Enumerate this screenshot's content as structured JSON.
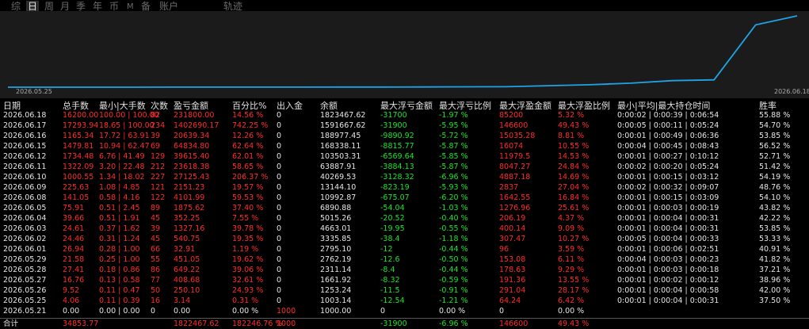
{
  "tabs": [
    {
      "label": "综",
      "active": false
    },
    {
      "label": "日",
      "active": true
    },
    {
      "label": "周",
      "active": false
    },
    {
      "label": "月",
      "active": false
    },
    {
      "label": "季",
      "active": false
    },
    {
      "label": "年",
      "active": false
    },
    {
      "label": "币",
      "active": false
    },
    {
      "label": "M",
      "active": false
    },
    {
      "label": "备",
      "active": false
    },
    {
      "label": "账户",
      "active": false
    },
    {
      "label": "轨迹",
      "active": false
    }
  ],
  "chart": {
    "start_label": "2026.05.25",
    "end_label": "2026.06.18",
    "line_color": "#1fa3e6",
    "curve": [
      1000.0,
      1003.14,
      1253.24,
      1661.92,
      2311.14,
      2762.19,
      2795.1,
      3335.85,
      4663.01,
      5015.26,
      6890.88,
      10992.87,
      13144.1,
      40269.53,
      63887.91,
      103503.31,
      168338.11,
      188977.45,
      1591667.62,
      1823467.62
    ]
  },
  "headers": {
    "date": "日期",
    "total_lots": "总手数",
    "minmax_lots": "最小|大手数",
    "count": "次数",
    "pnl": "盈亏金额",
    "pct": "百分比%",
    "inout": "出入金",
    "balance": "余额",
    "max_float_loss": "最大浮亏金额",
    "max_float_loss_pct": "最大浮亏比例",
    "max_float_profit": "最大浮盈金额",
    "max_float_profit_pct": "最大浮盈比例",
    "hold_time": "最小|平均|最大持仓时间",
    "winrate": "胜率"
  },
  "rows": [
    {
      "date": "2026.06.18",
      "lots": "16200.00",
      "minmax": "100.00 | 100.00",
      "count": "82",
      "pnl": "231800.00",
      "pct": "14.56 %",
      "inout": "0",
      "balance": "1823467.62",
      "mfl": "-31700",
      "mflp": "-1.97 %",
      "mfp": "85200",
      "mfpp": "5.32 %",
      "hold": "0:00:02 | 0:00:39 | 0:06:54",
      "win": "55.88 %"
    },
    {
      "date": "2026.06.17",
      "lots": "17293.94",
      "minmax": "18.65 | 100.00",
      "count": "234",
      "pnl": "1402690.17",
      "pct": "742.25 %",
      "inout": "0",
      "balance": "1591667.62",
      "mfl": "-31900",
      "mflp": "-5.95 %",
      "mfp": "146600",
      "mfpp": "49.43 %",
      "hold": "0:00:05 | 0:00:11 | 0:05:24",
      "win": "54.70 %"
    },
    {
      "date": "2026.06.16",
      "lots": "1165.34",
      "minmax": "17.72 | 63.91",
      "count": "39",
      "pnl": "20639.34",
      "pct": "12.26 %",
      "inout": "0",
      "balance": "188977.45",
      "mfl": "-9890.92",
      "mflp": "-5.72 %",
      "mfp": "15035.28",
      "mfpp": "8.81 %",
      "hold": "0:00:01 | 0:00:49 | 0:06:36",
      "win": "53.85 %"
    },
    {
      "date": "2026.06.15",
      "lots": "1479.81",
      "minmax": "10.94 | 62.47",
      "count": "69",
      "pnl": "64834.80",
      "pct": "62.64 %",
      "inout": "0",
      "balance": "168338.11",
      "mfl": "-8815.77",
      "mflp": "-5.87 %",
      "mfp": "16074",
      "mfpp": "10.55 %",
      "hold": "0:00:04 | 0:00:45 | 0:08:43",
      "win": "56.52 %"
    },
    {
      "date": "2026.06.12",
      "lots": "1734.48",
      "minmax": "6.76 | 41.49",
      "count": "129",
      "pnl": "39615.40",
      "pct": "62.01 %",
      "inout": "0",
      "balance": "103503.31",
      "mfl": "-6569.64",
      "mflp": "-5.85 %",
      "mfp": "11979.5",
      "mfpp": "14.53 %",
      "hold": "0:00:01 | 0:00:27 | 0:10:12",
      "win": "52.71 %"
    },
    {
      "date": "2026.06.11",
      "lots": "1322.09",
      "minmax": "3.20 | 22.48",
      "count": "212",
      "pnl": "23618.38",
      "pct": "58.65 %",
      "inout": "0",
      "balance": "63887.91",
      "mfl": "-3884.13",
      "mflp": "-5.87 %",
      "mfp": "8047.27",
      "mfpp": "24.84 %",
      "hold": "0:00:02 | 0:00:20 | 0:05:24",
      "win": "51.42 %"
    },
    {
      "date": "2026.06.10",
      "lots": "1000.55",
      "minmax": "1.34 | 18.02",
      "count": "227",
      "pnl": "27125.43",
      "pct": "206.37 %",
      "inout": "0",
      "balance": "40269.53",
      "mfl": "-3128.32",
      "mflp": "-6.96 %",
      "mfp": "4887.18",
      "mfpp": "14.69 %",
      "hold": "0:00:01 | 0:00:15 | 0:03:12",
      "win": "54.19 %"
    },
    {
      "date": "2026.06.09",
      "lots": "225.63",
      "minmax": "1.08 | 4.85",
      "count": "121",
      "pnl": "2151.23",
      "pct": "19.57 %",
      "inout": "0",
      "balance": "13144.10",
      "mfl": "-823.19",
      "mflp": "-5.93 %",
      "mfp": "2837",
      "mfpp": "27.04 %",
      "hold": "0:00:02 | 0:00:32 | 0:09:07",
      "win": "48.76 %"
    },
    {
      "date": "2026.06.08",
      "lots": "141.05",
      "minmax": "0.58 | 4.16",
      "count": "122",
      "pnl": "4101.99",
      "pct": "59.53 %",
      "inout": "0",
      "balance": "10992.87",
      "mfl": "-675.07",
      "mflp": "-6.20 %",
      "mfp": "1642.55",
      "mfpp": "16.84 %",
      "hold": "0:00:01 | 0:00:15 | 0:03:09",
      "win": "54.10 %"
    },
    {
      "date": "2026.06.05",
      "lots": "75.91",
      "minmax": "0.51 | 2.45",
      "count": "89",
      "pnl": "1875.62",
      "pct": "37.40 %",
      "inout": "0",
      "balance": "6890.88",
      "mfl": "-54.04",
      "mflp": "-1.03 %",
      "mfp": "1276.96",
      "mfpp": "25.61 %",
      "hold": "0:00:01 | 0:00:03 | 0:00:19",
      "win": "43.82 %"
    },
    {
      "date": "2026.06.04",
      "lots": "39.66",
      "minmax": "0.51 | 1.91",
      "count": "45",
      "pnl": "352.25",
      "pct": "7.55 %",
      "inout": "0",
      "balance": "5015.26",
      "mfl": "-20.52",
      "mflp": "-0.40 %",
      "mfp": "206.19",
      "mfpp": "4.37 %",
      "hold": "0:00:01 | 0:00:04 | 0:00:31",
      "win": "42.22 %"
    },
    {
      "date": "2026.06.03",
      "lots": "24.61",
      "minmax": "0.37 | 1.62",
      "count": "39",
      "pnl": "1327.16",
      "pct": "39.78 %",
      "inout": "0",
      "balance": "4663.01",
      "mfl": "-19.95",
      "mflp": "-0.55 %",
      "mfp": "400.14",
      "mfpp": "9.09 %",
      "hold": "0:00:01 | 0:00:04 | 0:00:31",
      "win": "53.85 %"
    },
    {
      "date": "2026.06.02",
      "lots": "24.46",
      "minmax": "0.31 | 1.24",
      "count": "45",
      "pnl": "540.75",
      "pct": "19.35 %",
      "inout": "0",
      "balance": "3335.85",
      "mfl": "-38.4",
      "mflp": "-1.18 %",
      "mfp": "307.47",
      "mfpp": "10.27 %",
      "hold": "0:00:05 | 0:00:04 | 0:00:33",
      "win": "53.33 %"
    },
    {
      "date": "2026.06.01",
      "lots": "26.94",
      "minmax": "0.28 | 1.00",
      "count": "66",
      "pnl": "32.91",
      "pct": "1.19 %",
      "inout": "0",
      "balance": "2795.10",
      "mfl": "-12",
      "mflp": "-0.44 %",
      "mfp": "96",
      "mfpp": "3.59 %",
      "hold": "0:00:01 | 0:00:06 | 0:02:51",
      "win": "40.91 %"
    },
    {
      "date": "2026.05.29",
      "lots": "21.58",
      "minmax": "0.25 | 1.00",
      "count": "55",
      "pnl": "451.05",
      "pct": "19.62 %",
      "inout": "0",
      "balance": "2762.19",
      "mfl": "-12.6",
      "mflp": "-0.50 %",
      "mfp": "153.08",
      "mfpp": "6.11 %",
      "hold": "0:00:04 | 0:00:03 | 0:00:23",
      "win": "41.82 %"
    },
    {
      "date": "2026.05.28",
      "lots": "27.41",
      "minmax": "0.18 | 0.86",
      "count": "86",
      "pnl": "649.22",
      "pct": "39.06 %",
      "inout": "0",
      "balance": "2311.14",
      "mfl": "-8.4",
      "mflp": "-0.44 %",
      "mfp": "178.63",
      "mfpp": "9.29 %",
      "hold": "0:00:01 | 0:00:03 | 0:00:18",
      "win": "37.21 %"
    },
    {
      "date": "2026.05.27",
      "lots": "16.76",
      "minmax": "0.13 | 0.58",
      "count": "77",
      "pnl": "408.68",
      "pct": "32.61 %",
      "inout": "0",
      "balance": "1661.92",
      "mfl": "-8.32",
      "mflp": "-0.59 %",
      "mfp": "191.36",
      "mfpp": "13.55 %",
      "hold": "0:00:01 | 0:00:02 | 0:00:12",
      "win": "38.96 %"
    },
    {
      "date": "2026.05.26",
      "lots": "9.52",
      "minmax": "0.11 | 0.47",
      "count": "50",
      "pnl": "250.10",
      "pct": "24.93 %",
      "inout": "0",
      "balance": "1253.24",
      "mfl": "-11.5",
      "mflp": "-0.91 %",
      "mfp": "291.04",
      "mfpp": "28.17 %",
      "hold": "0:00:01 | 0:00:04 | 0:00:58",
      "win": "42.00 %"
    },
    {
      "date": "2026.05.25",
      "lots": "4.06",
      "minmax": "0.11 | 0.39",
      "count": "16",
      "pnl": "3.14",
      "pct": "0.31 %",
      "inout": "0",
      "balance": "1003.14",
      "mfl": "-12.54",
      "mflp": "-1.21 %",
      "mfp": "64.24",
      "mfpp": "6.42 %",
      "hold": "0:00:01 | 0:00:04 | 0:00:31",
      "win": "37.50 %"
    },
    {
      "date": "2026.05.21",
      "lots": "0.00",
      "minmax": "0.00 | 0.00",
      "count": "0",
      "pnl": "0.00",
      "pct": "0.00 %",
      "inout": "1000",
      "balance": "1000.00",
      "mfl": "0",
      "mflp": "0.00 %",
      "mfp": "0",
      "mfpp": "0.00 %",
      "hold": "",
      "win": ""
    }
  ],
  "total": {
    "label": "合计",
    "lots": "34853.77",
    "pnl": "1822467.62",
    "pct": "182246.76 %",
    "inout": "1000",
    "mfl": "-31900",
    "mflp": "-6.96 %",
    "mfp": "146600",
    "mfpp": "49.43 %"
  }
}
